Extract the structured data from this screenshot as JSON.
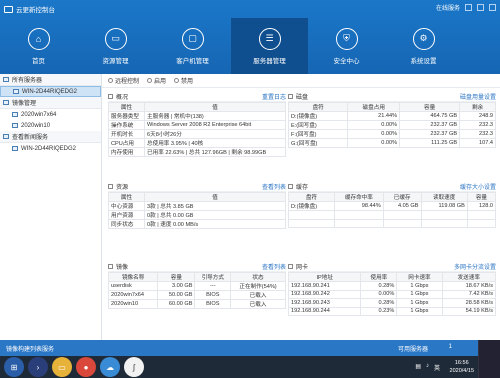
{
  "app": {
    "title": "云更新控制台",
    "online_status": "在线服务"
  },
  "nav": [
    {
      "label": "首页",
      "icon": "home-icon",
      "glyph": "⌂"
    },
    {
      "label": "资源管理",
      "icon": "folder-icon",
      "glyph": "▭"
    },
    {
      "label": "客户机管理",
      "icon": "monitor-icon",
      "glyph": "▢"
    },
    {
      "label": "服务器管理",
      "icon": "server-icon",
      "glyph": "☰"
    },
    {
      "label": "安全中心",
      "icon": "shield-icon",
      "glyph": "⛨"
    },
    {
      "label": "系统设置",
      "icon": "gear-icon",
      "glyph": "⚙"
    }
  ],
  "sidebar": {
    "group_servers": "所有服务器",
    "server_item": "WIN-2D44RIQEDG2",
    "group_images": "镜像管理",
    "images": [
      "2020win7x64",
      "2020win10"
    ],
    "group_view": "查看新闻服务",
    "view_item": "WIN-2D44RIQEDG2"
  },
  "toolbar": {
    "remote": "远程控制",
    "enable": "启用",
    "disable": "禁用"
  },
  "overview": {
    "title": "概况",
    "link": "重置日志",
    "headers": [
      "属性",
      "值"
    ],
    "rows": [
      [
        "服务器类型",
        "主服务器 | 常机中(138)"
      ],
      [
        "操作系统",
        "Windows Server 2008 R2 Enterprise 64bit"
      ],
      [
        "开机时长",
        "6天8小时26分"
      ],
      [
        "CPU占用",
        "总使用率 3.95% | 40核"
      ],
      [
        "内存使用",
        "已用率 22.63% | 总共 127.96GB | 剩余 98.99GB"
      ]
    ]
  },
  "disk": {
    "title": "磁盘",
    "link": "磁盘用量设置",
    "headers": [
      "盘符",
      "磁盘占用",
      "容量",
      "剩余"
    ],
    "rows": [
      [
        "D:(镜像盘)",
        "21.44%",
        "464.75 GB",
        "248.9"
      ],
      [
        "E:(回写盘)",
        "0.00%",
        "232.37 GB",
        "232.3"
      ],
      [
        "F:(回写盘)",
        "0.00%",
        "232.37 GB",
        "232.3"
      ],
      [
        "G:(回写盘)",
        "0.00%",
        "111.25 GB",
        "107.4"
      ]
    ]
  },
  "resources": {
    "title": "资源",
    "link": "查看列表",
    "headers": [
      "属性",
      "值"
    ],
    "rows": [
      [
        "中心资源",
        "3款 | 总共 3.85 GB"
      ],
      [
        "用户资源",
        "0款 | 总共 0.00 GB"
      ],
      [
        "同步状态",
        "0款 | 速度 0.00 MB/s"
      ]
    ]
  },
  "cache": {
    "title": "缓存",
    "link": "缓存大小设置",
    "headers": [
      "盘符",
      "缓存命中率",
      "已缓存",
      "读取速度",
      "容量"
    ],
    "rows": [
      [
        "D:(镜像盘)",
        "98.44%",
        "4.05 GB",
        "119.08 GB",
        "128.0"
      ]
    ]
  },
  "image_panel": {
    "title": "镜像",
    "link": "查看列表",
    "headers": [
      "镜像名称",
      "容量",
      "引导方式",
      "状态"
    ],
    "rows": [
      [
        "userdisk",
        "3.00 GB",
        "---",
        "正在制作(54%)"
      ],
      [
        "2020win7x64",
        "50.00 GB",
        "BIOS",
        "已载入"
      ],
      [
        "2020win10",
        "60.00 GB",
        "BIOS",
        "已载入"
      ]
    ]
  },
  "network": {
    "title": "网卡",
    "link": "多网卡分流设置",
    "headers": [
      "IP地址",
      "使用率",
      "网卡速率",
      "发送速率"
    ],
    "rows": [
      [
        "192.168.90.241",
        "0.28%",
        "1 Gbps",
        "18.67 KB/s"
      ],
      [
        "192.168.90.242",
        "0.00%",
        "1 Gbps",
        "7.42 KB/s"
      ],
      [
        "192.168.90.243",
        "0.28%",
        "1 Gbps",
        "28.58 KB/s"
      ],
      [
        "192.168.90.244",
        "0.23%",
        "1 Gbps",
        "54.19 KB/s"
      ]
    ]
  },
  "status": {
    "left": "镜像构建列表服务",
    "available": "可用服务器",
    "count": "1"
  },
  "taskbar": {
    "time": "16:56",
    "date": "2020/4/15",
    "lang": "英"
  },
  "colors": {
    "primary": "#1b77c9",
    "nav_active": "#0f4f8f",
    "status_bar": "#2a77c6",
    "link": "#2a74c4"
  }
}
